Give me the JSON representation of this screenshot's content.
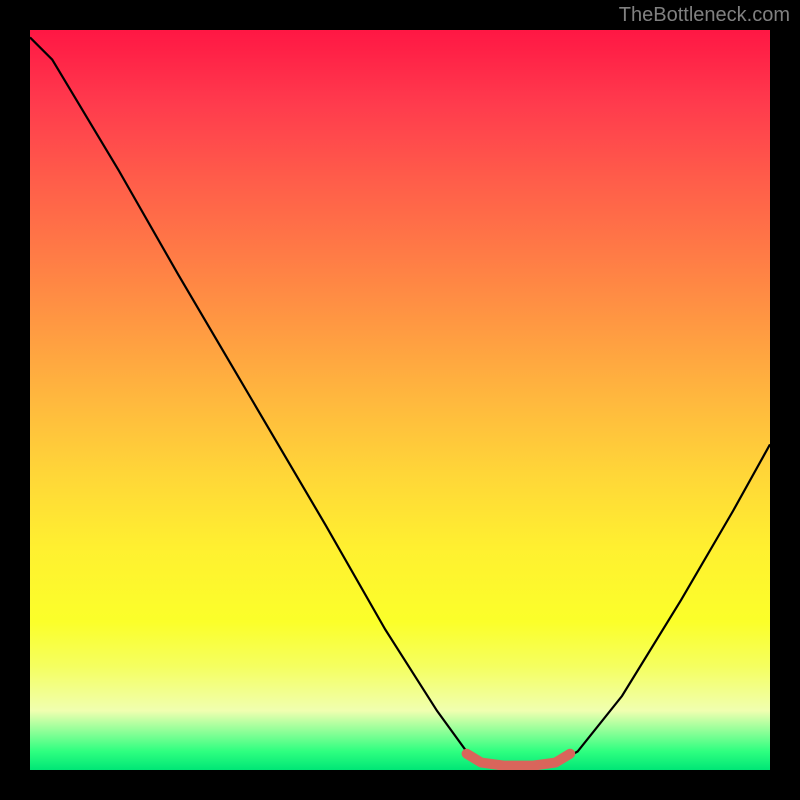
{
  "watermark": "TheBottleneck.com",
  "chart_data": {
    "type": "line",
    "description": "Bottleneck curve over a green-to-red vertical gradient. Y axis (implied): bottleneck severity, 0 at bottom (green) to ~100 at top (red). X axis (implied): configuration parameter 0–100. Curve starts near top-left, descends to a flat minimum around x≈62–72, then rises toward the right edge. The flat minimum segment is highlighted with a thick salmon stroke.",
    "xlim": [
      0,
      100
    ],
    "ylim": [
      0,
      100
    ],
    "series": [
      {
        "name": "bottleneck-curve",
        "points": [
          {
            "x": 0,
            "y": 99
          },
          {
            "x": 3,
            "y": 96
          },
          {
            "x": 6,
            "y": 91
          },
          {
            "x": 12,
            "y": 81
          },
          {
            "x": 20,
            "y": 67
          },
          {
            "x": 30,
            "y": 50
          },
          {
            "x": 40,
            "y": 33
          },
          {
            "x": 48,
            "y": 19
          },
          {
            "x": 55,
            "y": 8
          },
          {
            "x": 59,
            "y": 2.5
          },
          {
            "x": 62,
            "y": 0.8
          },
          {
            "x": 65,
            "y": 0.5
          },
          {
            "x": 68,
            "y": 0.5
          },
          {
            "x": 71,
            "y": 0.8
          },
          {
            "x": 74,
            "y": 2.5
          },
          {
            "x": 80,
            "y": 10
          },
          {
            "x": 88,
            "y": 23
          },
          {
            "x": 95,
            "y": 35
          },
          {
            "x": 100,
            "y": 44
          }
        ]
      }
    ],
    "highlight_segment": {
      "color": "#d9655b",
      "points": [
        {
          "x": 59,
          "y": 2.2
        },
        {
          "x": 61,
          "y": 1.0
        },
        {
          "x": 64,
          "y": 0.6
        },
        {
          "x": 68,
          "y": 0.6
        },
        {
          "x": 71,
          "y": 1.0
        },
        {
          "x": 73,
          "y": 2.2
        }
      ]
    }
  }
}
